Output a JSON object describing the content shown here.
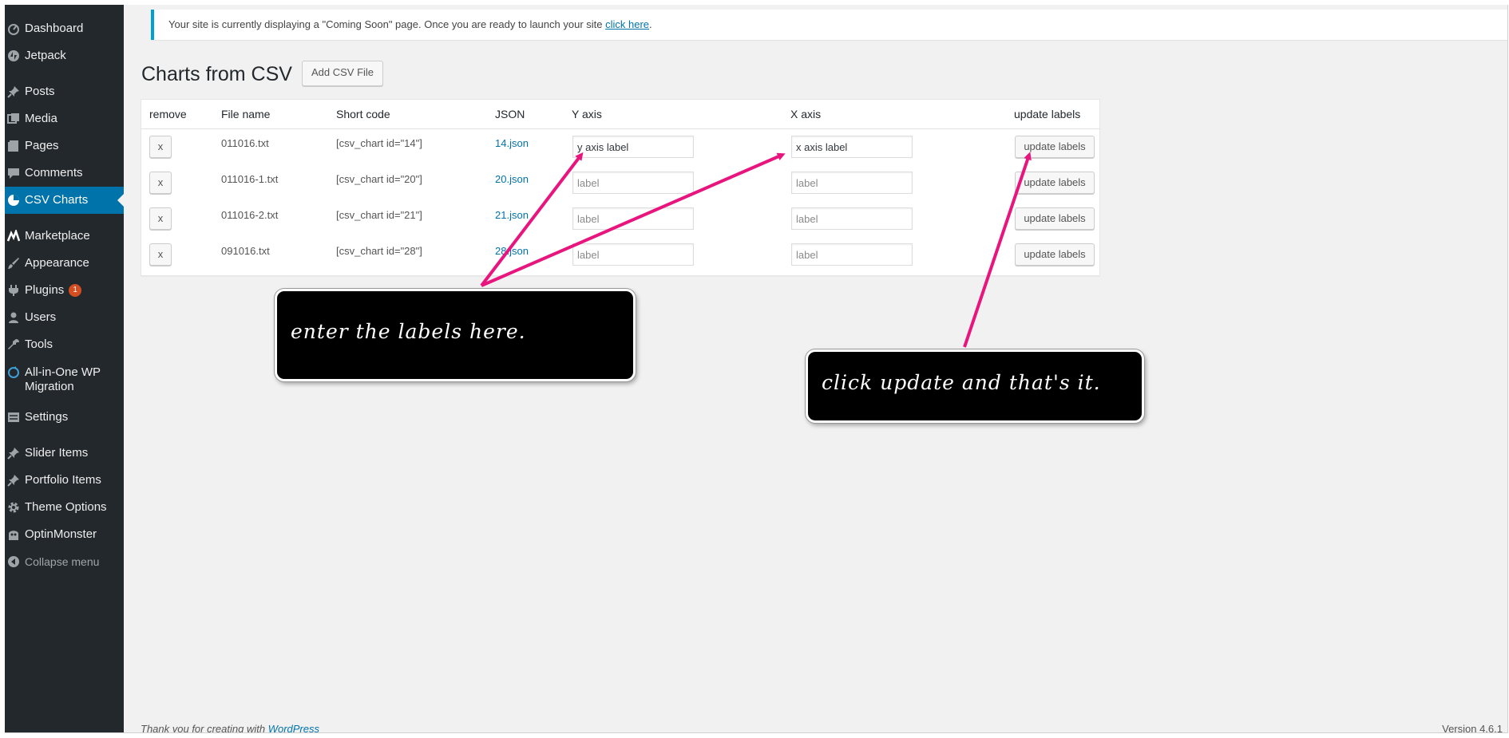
{
  "sidebar": {
    "items": [
      {
        "label": "Dashboard",
        "icon": "dashboard-icon"
      },
      {
        "label": "Jetpack",
        "icon": "jetpack-icon"
      },
      {
        "label": "Posts",
        "icon": "pin-icon"
      },
      {
        "label": "Media",
        "icon": "media-icon"
      },
      {
        "label": "Pages",
        "icon": "page-icon"
      },
      {
        "label": "Comments",
        "icon": "comment-icon"
      },
      {
        "label": "CSV Charts",
        "icon": "pie-chart-icon",
        "active": true
      },
      {
        "label": "Marketplace",
        "icon": "marketplace-icon"
      },
      {
        "label": "Appearance",
        "icon": "brush-icon"
      },
      {
        "label": "Plugins",
        "icon": "plugin-icon",
        "badge": "1"
      },
      {
        "label": "Users",
        "icon": "user-icon"
      },
      {
        "label": "Tools",
        "icon": "wrench-icon"
      },
      {
        "label": "All-in-One WP Migration",
        "icon": "migration-icon"
      },
      {
        "label": "Settings",
        "icon": "settings-icon"
      },
      {
        "label": "Slider Items",
        "icon": "pin-icon"
      },
      {
        "label": "Portfolio Items",
        "icon": "pin-icon"
      },
      {
        "label": "Theme Options",
        "icon": "gear-icon"
      },
      {
        "label": "OptinMonster",
        "icon": "monster-icon"
      },
      {
        "label": "Collapse menu",
        "icon": "collapse-icon"
      }
    ]
  },
  "notice": {
    "text": "Your site is currently displaying a \"Coming Soon\" page. Once you are ready to launch your site ",
    "link": "click here",
    "suffix": "."
  },
  "page": {
    "title": "Charts from CSV",
    "add_button": "Add CSV File"
  },
  "table": {
    "headers": [
      "remove",
      "File name",
      "Short code",
      "JSON",
      "Y axis",
      "X axis",
      "update labels"
    ],
    "rows": [
      {
        "remove": "x",
        "file": "011016.txt",
        "shortcode": "[csv_chart id=\"14\"]",
        "json": "14.json",
        "y_value": "y axis label",
        "x_value": "x axis label",
        "placeholder": "label",
        "button": "update labels"
      },
      {
        "remove": "x",
        "file": "011016-1.txt",
        "shortcode": "[csv_chart id=\"20\"]",
        "json": "20.json",
        "y_value": "",
        "x_value": "",
        "placeholder": "label",
        "button": "update labels"
      },
      {
        "remove": "x",
        "file": "011016-2.txt",
        "shortcode": "[csv_chart id=\"21\"]",
        "json": "21.json",
        "y_value": "",
        "x_value": "",
        "placeholder": "label",
        "button": "update labels"
      },
      {
        "remove": "x",
        "file": "091016.txt",
        "shortcode": "[csv_chart id=\"28\"]",
        "json": "28.json",
        "y_value": "",
        "x_value": "",
        "placeholder": "label",
        "button": "update labels"
      }
    ]
  },
  "callouts": {
    "left": "enter the labels here.",
    "right": "click update and that's it."
  },
  "colors": {
    "sidebar_bg": "#23282d",
    "active": "#0073aa",
    "arrow": "#e8157f",
    "link": "#0073aa",
    "badge": "#d54e21"
  },
  "footer": {
    "text": "Thank you for creating with ",
    "link": "WordPress",
    "version": "Version 4.6.1"
  }
}
